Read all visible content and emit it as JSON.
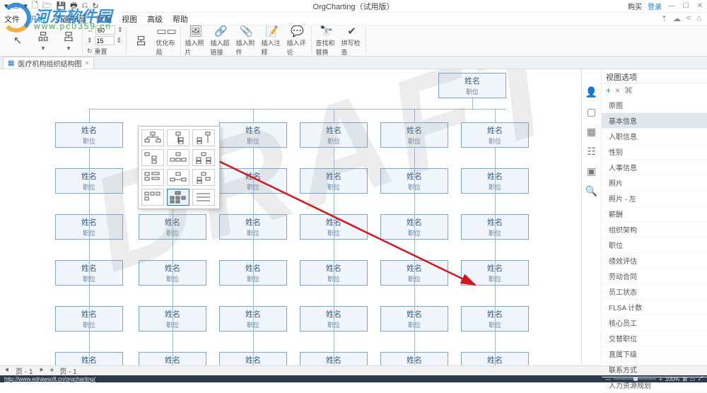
{
  "app": {
    "title": "OrgCharting（试用版）"
  },
  "qat": [
    "▾",
    "☐",
    "▾",
    "🗋",
    "🗁",
    "💾",
    "🖶",
    "⎌",
    "↻"
  ],
  "winbar": {
    "buy": "购买",
    "login": "登录",
    "min": "—",
    "max": "☐",
    "close": "✕"
  },
  "menus": [
    "文件",
    "开始",
    "页面布局",
    "数据",
    "视图",
    "高级",
    "帮助"
  ],
  "menu_right_icons": [
    "⇡",
    "☁",
    "<",
    "⌂"
  ],
  "ribbon": {
    "cursor": "",
    "layout_label": "",
    "autolayout_label": "",
    "spacing_w": "60",
    "spacing_h": "15",
    "reset": "重置",
    "optimize": "优化布局",
    "insert_photo": "插入照片",
    "hyperlink": "插入超链接",
    "attach": "插入附件",
    "note": "插入注释",
    "comment": "插入评论",
    "findreplace": "查找和替换",
    "spellcheck": "拼写检查"
  },
  "tab": {
    "icon": "▦",
    "name": "医疗机构组织结构图",
    "close": "×"
  },
  "watermark": "DRAFT",
  "node": {
    "name": "姓名",
    "position": "职位"
  },
  "side": {
    "header": "视图选项",
    "plus": "+",
    "x": "×",
    "link": "⌘",
    "icons": [
      "👤",
      "▢",
      "▦",
      "☷",
      "▣",
      "🔍"
    ],
    "items": [
      "原图",
      "基本信息",
      "入职信息",
      "性别",
      "人事信息",
      "照片",
      "照片 - 左",
      "薪酬",
      "组织架构",
      "职位",
      "绩效评估",
      "劳动合同",
      "员工状态",
      "FLSA 计数",
      "核心员工",
      "交替职位",
      "直属下级",
      "联系方式",
      "人力资源规划"
    ]
  },
  "pagebar": {
    "prev": "⯇",
    "label": "页 - 1",
    "next": "⯈",
    "plus": "+",
    "another": "页 - 1"
  },
  "status": {
    "url": "http://www.edrawsoft.cn/orgcharting/",
    "zminus": "—",
    "zplus": "+",
    "zoom": "100%",
    "view_icons": [
      "⊞",
      "▭",
      "⤢"
    ]
  },
  "logo": {
    "text": "河东软件园",
    "url": "www.pc0359.cn"
  }
}
